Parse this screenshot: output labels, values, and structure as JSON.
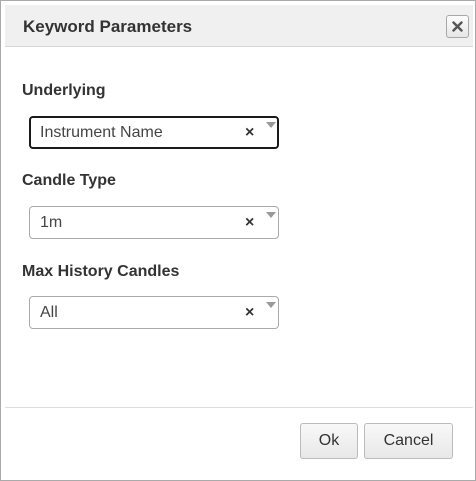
{
  "dialog": {
    "title": "Keyword Parameters",
    "close_icon": "close-x-icon"
  },
  "fields": {
    "underlying": {
      "label": "Underlying",
      "value": "Instrument Name",
      "clear": "×",
      "focused": true
    },
    "candle_type": {
      "label": "Candle Type",
      "value": "1m",
      "clear": "×"
    },
    "max_history": {
      "label": "Max History Candles",
      "value": "All",
      "clear": "×"
    }
  },
  "buttons": {
    "ok": "Ok",
    "cancel": "Cancel"
  },
  "colors": {
    "titlebar_bg": "#f0f0f0",
    "border": "#aaaaaa",
    "focus_border": "#1a1a1a",
    "text": "#333333"
  }
}
